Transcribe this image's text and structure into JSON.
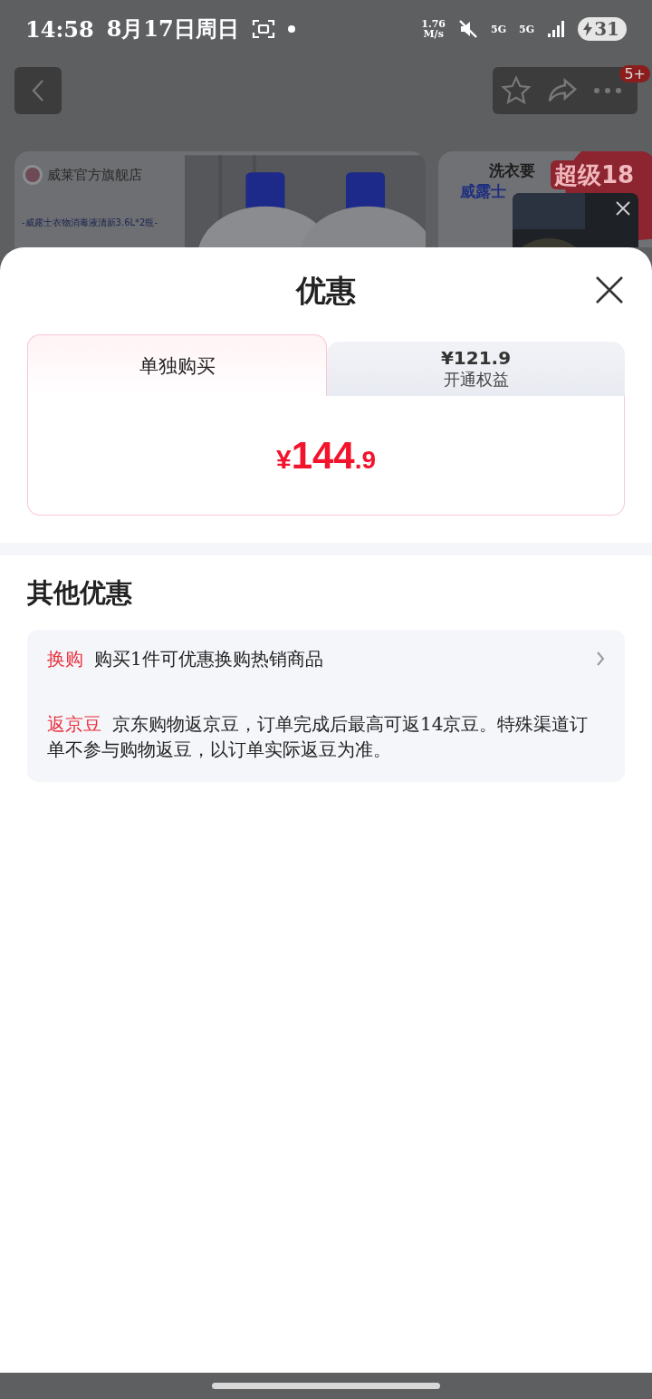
{
  "status_bar": {
    "time": "14:58",
    "date": "8月17日周日",
    "speed_value": "1.76",
    "speed_unit": "M/s",
    "network_1": "5G",
    "network_2": "5G",
    "battery": "31"
  },
  "nav": {
    "badge": "5+"
  },
  "banners": [
    {
      "store": "威莱官方旗舰店",
      "subtitle": "-威露士衣物消毒液清新3.6L*2瓶-"
    },
    {
      "line_1": "洗衣要",
      "line_2": "威露士",
      "sticker": "超级18"
    }
  ],
  "sheet": {
    "title": "优惠",
    "tabs": [
      {
        "label": "单独购买",
        "selected": true
      },
      {
        "price": "¥121.9",
        "label": "开通权益",
        "selected": false
      }
    ],
    "price": {
      "symbol": "¥",
      "integer": "144",
      "decimal": ".9"
    },
    "section_title": "其他优惠",
    "offers": [
      {
        "kind": "link",
        "tag": "换购",
        "text": "购买1件可优惠换购热销商品"
      },
      {
        "kind": "info",
        "tag": "返京豆",
        "text": "京东购物返京豆，订单完成后最高可返14京豆。特殊渠道订单不参与购物返豆，以订单实际返豆为准。"
      }
    ]
  }
}
